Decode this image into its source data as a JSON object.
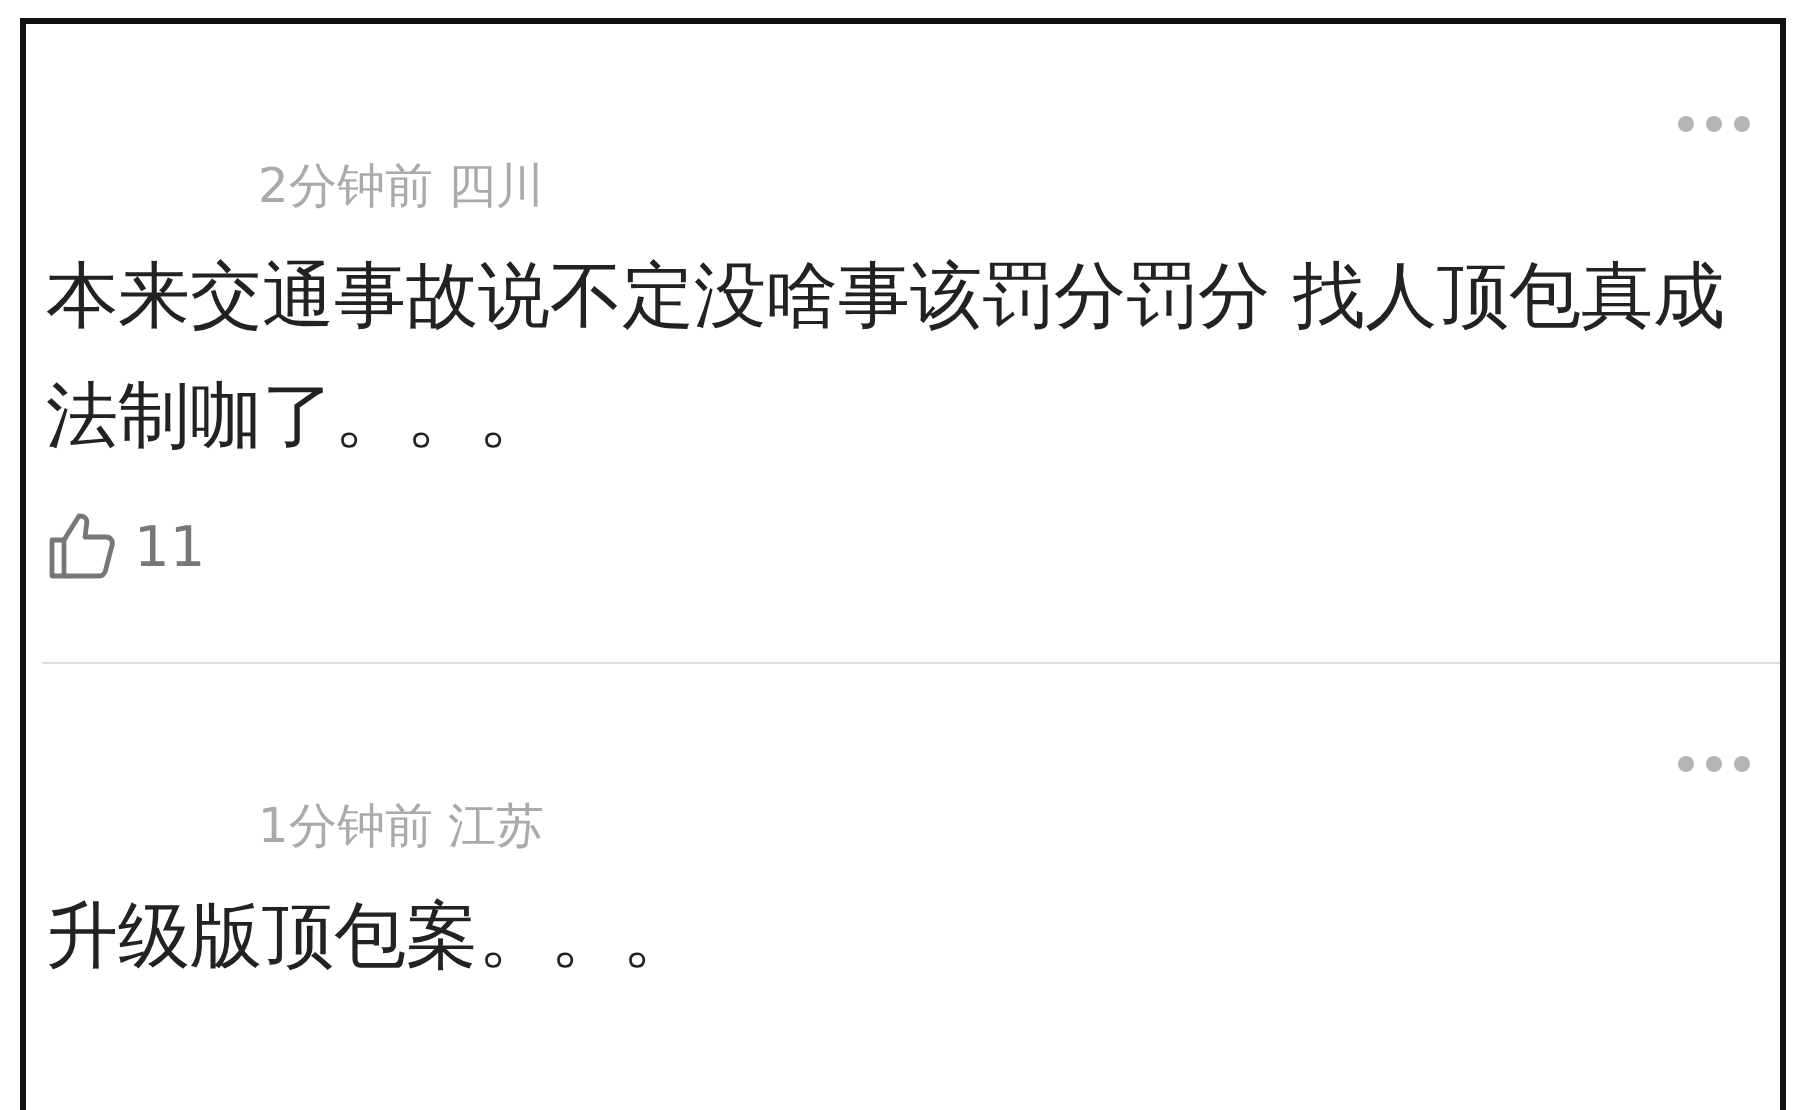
{
  "comments": [
    {
      "meta": "2分钟前 四川",
      "text": "本来交通事故说不定没啥事该罚分罚分 找人顶包真成法制咖了。。。",
      "likes": "11"
    },
    {
      "meta": "1分钟前 江苏",
      "text": "升级版顶包案。。。"
    }
  ]
}
